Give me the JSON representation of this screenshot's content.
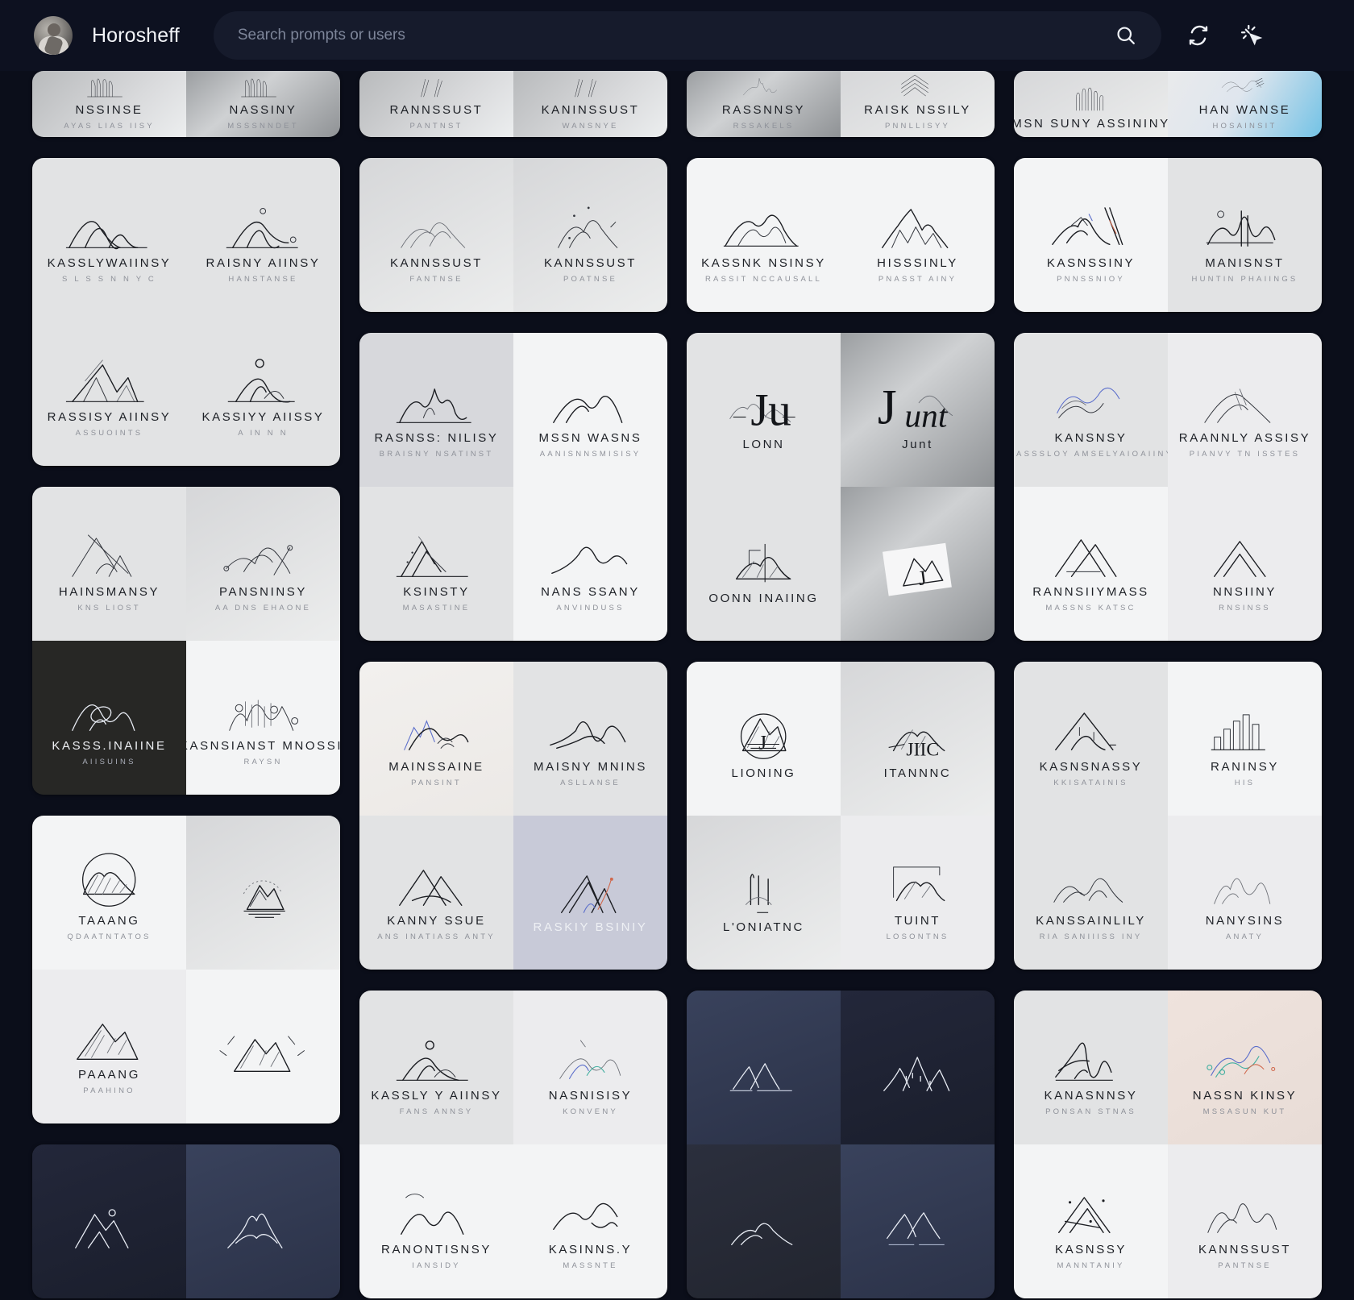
{
  "header": {
    "username": "Horosheff",
    "search": {
      "placeholder": "Search prompts or users",
      "value": ""
    },
    "icons": {
      "search": "search-icon",
      "refresh": "refresh-icon",
      "cursor": "cursor-click-icon"
    }
  },
  "columns": [
    {
      "cards": [
        {
          "clipped": true,
          "tiles": [
            {
              "title": "NSSINSE",
              "sub": "AYAS LIAS IISY",
              "bg": "bg-e",
              "art": "ridge-thin"
            },
            {
              "title": "NASSINY",
              "sub": "MSSSNNDET",
              "bg": "bg-silver",
              "art": "ridge-thin"
            }
          ]
        },
        {
          "tiles": [
            {
              "title": "KASSLYWAIINSY",
              "sub": "S L S S N N Y C",
              "bg": "bg-c",
              "art": "double-peak"
            },
            {
              "title": "RAISNY AIINSY",
              "sub": "HANSTANSE",
              "bg": "bg-c",
              "art": "peak-dots"
            },
            {
              "title": "RASSISY AIINSY",
              "sub": "ASSUOINTS",
              "bg": "bg-c",
              "art": "sharp-ridge"
            },
            {
              "title": "KASSIYY AIISSY",
              "sub": "A IN N N",
              "bg": "bg-c",
              "art": "sun-peak"
            }
          ]
        },
        {
          "tiles": [
            {
              "title": "HAINSMANSY",
              "sub": "KNS LIOST",
              "bg": "bg-c",
              "art": "angular-peak"
            },
            {
              "title": "PANSNINSY",
              "sub": "AA DNS EHAONE",
              "bg": "bg-b",
              "art": "wire-peak"
            },
            {
              "title": "KASSS.INAIINE",
              "sub": "AIISUINS",
              "bg": "bg-dark1",
              "art": "loop-peak",
              "dark": true
            },
            {
              "title": "IKASNSIANST MNOSSIZ",
              "sub": "RAYSN",
              "bg": "bg-d",
              "art": "scratch-range"
            }
          ]
        },
        {
          "tiles": [
            {
              "title": "TAAANG",
              "sub": "QDAATNTATOS",
              "bg": "bg-d",
              "art": "circle-badge"
            },
            {
              "title": "",
              "sub": "",
              "bg": "bg-b",
              "art": "sun-lines-peak"
            },
            {
              "title": "PAAANG",
              "sub": "PAAHINO",
              "bg": "bg-f",
              "art": "sketch-peak"
            },
            {
              "title": "",
              "sub": "",
              "bg": "bg-d",
              "art": "burst-peak"
            }
          ]
        },
        {
          "tiles": [
            {
              "title": "",
              "sub": "",
              "bg": "bg-dark3",
              "art": "night-peak",
              "dark": true
            },
            {
              "title": "",
              "sub": "",
              "bg": "bg-dark5",
              "art": "snow-peak",
              "dark": true
            }
          ]
        }
      ]
    },
    {
      "cards": [
        {
          "clipped": true,
          "tiles": [
            {
              "title": "RANNSSUST",
              "sub": "PANTNST",
              "bg": "bg-e",
              "art": "slash-peak"
            },
            {
              "title": "KANINSSUST",
              "sub": "WANSNYE",
              "bg": "bg-e",
              "art": "slash-peak"
            }
          ]
        },
        {
          "tiles": [
            {
              "title": "KANNSSUST",
              "sub": "FANTNSE",
              "bg": "bg-b",
              "art": "soft-triple"
            },
            {
              "title": "KANNSSUST",
              "sub": "POATNSE",
              "bg": "bg-b",
              "art": "dot-triple"
            }
          ]
        },
        {
          "tiles": [
            {
              "title": "RASNSS: NILISY",
              "sub": "BRAISNY NSATINST",
              "bg": "bg-h",
              "art": "scribble-peak"
            },
            {
              "title": "MSSN WASNS",
              "sub": "AANISNNSMISISY",
              "bg": "bg-d",
              "art": "clean-triple"
            },
            {
              "title": "KSINSTY",
              "sub": "MASASTINE",
              "bg": "bg-c",
              "art": "spike-peak"
            },
            {
              "title": "NANS SSANY",
              "sub": "ANVINDUSS",
              "bg": "bg-d",
              "art": "wave-peak"
            }
          ]
        },
        {
          "tiles": [
            {
              "title": "MAINSSAINE",
              "sub": "PANSINT",
              "bg": "bg-i",
              "art": "blue-range"
            },
            {
              "title": "MAISNY MNINS",
              "sub": "ASLLANSE",
              "bg": "bg-c",
              "art": "wave-two"
            },
            {
              "title": "KANNY SSUE",
              "sub": "ANS INATIASS ANTY",
              "bg": "bg-c",
              "art": "tri-cross"
            },
            {
              "title": "RASKIY BSINIY",
              "sub": "",
              "bg": "bg-lilac",
              "art": "color-spike",
              "dark": true
            }
          ]
        },
        {
          "tiles": [
            {
              "title": "KASSLY Y AIINSY",
              "sub": "FANS ANNSY",
              "bg": "bg-c",
              "art": "ring-peak"
            },
            {
              "title": "NASNISISY",
              "sub": "KONVENY",
              "bg": "bg-f",
              "art": "pastel-peak"
            },
            {
              "title": "RANONTISNSY",
              "sub": "IANSIDY",
              "bg": "bg-d",
              "art": "twin-arc"
            },
            {
              "title": "KASINNS.Y",
              "sub": "MASSNTE",
              "bg": "bg-d",
              "art": "flow-peak"
            }
          ]
        }
      ]
    },
    {
      "cards": [
        {
          "clipped": true,
          "tiles": [
            {
              "title": "RASSNNSY",
              "sub": "RSSAKELS",
              "bg": "bg-silver",
              "art": "thin-squiggle"
            },
            {
              "title": "RAISK NSSILY",
              "sub": "PNNLLISYY",
              "bg": "bg-b",
              "art": "chevron-stack"
            }
          ]
        },
        {
          "tiles": [
            {
              "title": "KASSNK NSINSY",
              "sub": "RASSIT NCCAUSALL",
              "bg": "bg-d",
              "art": "layered-range"
            },
            {
              "title": "HISSSINLY",
              "sub": "PNASST AINY",
              "bg": "bg-d",
              "art": "alpine-range"
            }
          ]
        },
        {
          "tiles": [
            {
              "title": "LONN",
              "sub": "",
              "bg": "bg-c",
              "art": "mono-ju"
            },
            {
              "title": "Junt",
              "sub": "",
              "bg": "bg-silver",
              "art": "script-j"
            },
            {
              "title": "OONN INAIING",
              "sub": "",
              "bg": "bg-c",
              "art": "mono-j-line"
            },
            {
              "title": "",
              "sub": "",
              "bg": "bg-silver",
              "art": "paper-j"
            }
          ]
        },
        {
          "tiles": [
            {
              "title": "LIONING",
              "sub": "",
              "bg": "bg-d",
              "art": "circle-j-badge"
            },
            {
              "title": "ITANNNC",
              "sub": "",
              "bg": "bg-b",
              "art": "jiic-mark"
            },
            {
              "title": "L'ONIATNC",
              "sub": "",
              "bg": "bg-b",
              "art": "pillars-peak"
            },
            {
              "title": "TUINT",
              "sub": "LOSONTNS",
              "bg": "bg-f",
              "art": "frame-peak"
            }
          ]
        },
        {
          "tiles": [
            {
              "title": "",
              "sub": "",
              "bg": "bg-dark5",
              "art": "night-twin",
              "dark": true
            },
            {
              "title": "",
              "sub": "",
              "bg": "bg-dark3",
              "art": "night-range",
              "dark": true
            },
            {
              "title": "",
              "sub": "",
              "bg": "bg-dark4",
              "art": "night-soft",
              "dark": true
            },
            {
              "title": "",
              "sub": "",
              "bg": "bg-dark5",
              "art": "night-lake",
              "dark": true
            }
          ]
        }
      ]
    },
    {
      "cards": [
        {
          "clipped": true,
          "tiles": [
            {
              "title": "MSN SUNY ASSININY",
              "sub": "",
              "bg": "bg-b",
              "art": "comb-peak"
            },
            {
              "title": "HAN WANSE",
              "sub": "HOSAINSIT",
              "bg": "bg-blue",
              "art": "soft-wave"
            }
          ]
        },
        {
          "tiles": [
            {
              "title": "KASNSSINY",
              "sub": "PNNSSNIOY",
              "bg": "bg-d",
              "art": "accent-peak"
            },
            {
              "title": "MANISNST",
              "sub": "HUNTIN PHAIINGS",
              "bg": "bg-c",
              "art": "ring-wave"
            }
          ]
        },
        {
          "tiles": [
            {
              "title": "KANSNSY",
              "sub": "RASSSLOY AMSELYAIOAIINY",
              "bg": "bg-c",
              "art": "blue-curve"
            },
            {
              "title": "RAANNLY ASSISY",
              "sub": "PIANVY TN ISSTES",
              "bg": "bg-f",
              "art": "tall-slope"
            },
            {
              "title": "RANNSIIYMASS",
              "sub": "MASSNS KATSC",
              "bg": "bg-d",
              "art": "x-peak"
            },
            {
              "title": "NNSIINY",
              "sub": "RNSINSS",
              "bg": "bg-f",
              "art": "chevron-peak"
            }
          ]
        },
        {
          "tiles": [
            {
              "title": "KASNSNASSY",
              "sub": "KKISATAINIS",
              "bg": "bg-c",
              "art": "tent-peak"
            },
            {
              "title": "RANINSY",
              "sub": "HIS",
              "bg": "bg-d",
              "art": "bars-peak"
            },
            {
              "title": "KANSSAINLILY",
              "sub": "RIA SANIIISS INY",
              "bg": "bg-c",
              "art": "rounded-range"
            },
            {
              "title": "NANYSINS",
              "sub": "ANATY",
              "bg": "bg-f",
              "art": "light-triple"
            }
          ]
        },
        {
          "tiles": [
            {
              "title": "KANASNNSY",
              "sub": "PONSAN STNAS",
              "bg": "bg-c",
              "art": "ink-peak"
            },
            {
              "title": "NASSN KINSY",
              "sub": "MSSASUN KUT",
              "bg": "bg-pinky",
              "art": "rainbow-peak"
            },
            {
              "title": "KASNSSY",
              "sub": "MANNTANIY",
              "bg": "bg-d",
              "art": "star-peak"
            },
            {
              "title": "KANNSSUST",
              "sub": "PANTNSE",
              "bg": "bg-f",
              "art": "squiggle-range"
            }
          ]
        }
      ]
    }
  ]
}
